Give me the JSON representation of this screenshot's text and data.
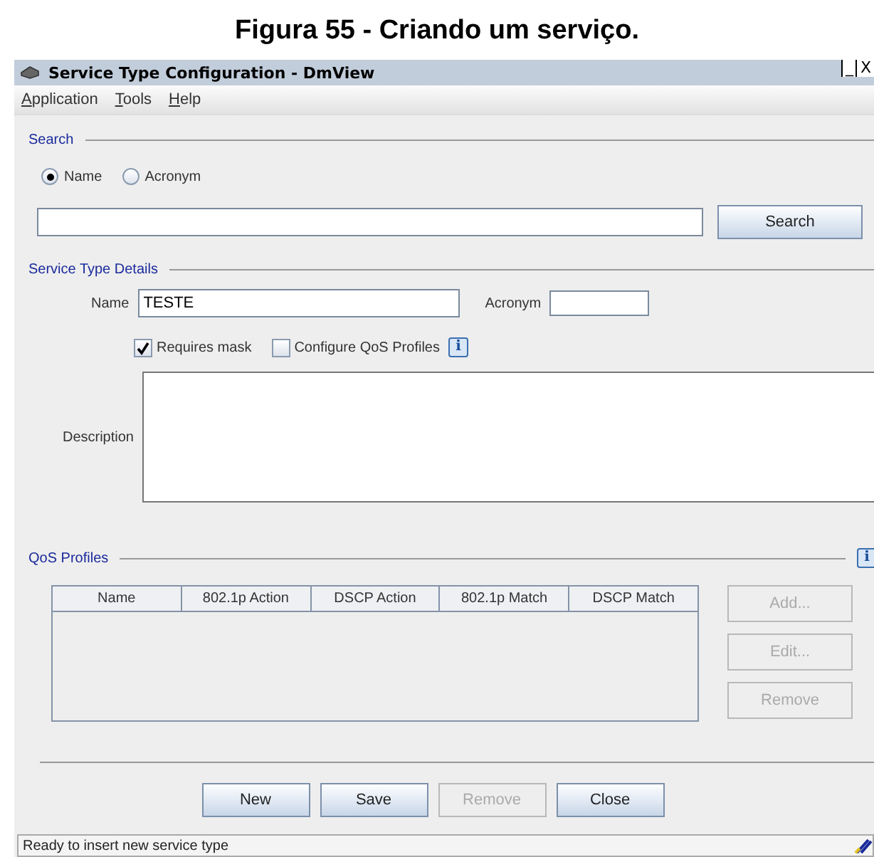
{
  "caption": "Figura 55 - Criando um serviço.",
  "window": {
    "title": "Service Type Configuration - DmView",
    "controls": [
      "_",
      "X"
    ]
  },
  "menu": [
    {
      "label": "Application",
      "underline_first": true
    },
    {
      "label": "Tools",
      "underline_first": true
    },
    {
      "label": "Help",
      "underline_first": true
    }
  ],
  "search": {
    "title": "Search",
    "options": [
      {
        "label": "Name",
        "selected": true
      },
      {
        "label": "Acronym",
        "selected": false
      }
    ],
    "button": "Search"
  },
  "details": {
    "title": "Service Type Details",
    "name_label": "Name",
    "name_value": "TESTE",
    "acronym_label": "Acronym",
    "checkboxes": [
      {
        "label": "Requires mask",
        "checked": true
      },
      {
        "label": "Configure QoS Profiles",
        "checked": false
      }
    ],
    "info_icon": "i",
    "description_label": "Description"
  },
  "qos": {
    "title": "QoS Profiles",
    "info_icon": "i",
    "columns": [
      "Name",
      "802.1p Action",
      "DSCP Action",
      "802.1p Match",
      "DSCP Match"
    ],
    "buttons": [
      {
        "label": "Add...",
        "disabled": true
      },
      {
        "label": "Edit...",
        "disabled": true
      },
      {
        "label": "Remove",
        "disabled": true
      }
    ]
  },
  "buttons": [
    {
      "label": "New",
      "disabled": false
    },
    {
      "label": "Save",
      "disabled": false
    },
    {
      "label": "Remove",
      "disabled": true
    },
    {
      "label": "Close",
      "disabled": false
    }
  ],
  "status_bar": "Ready to insert new service type"
}
